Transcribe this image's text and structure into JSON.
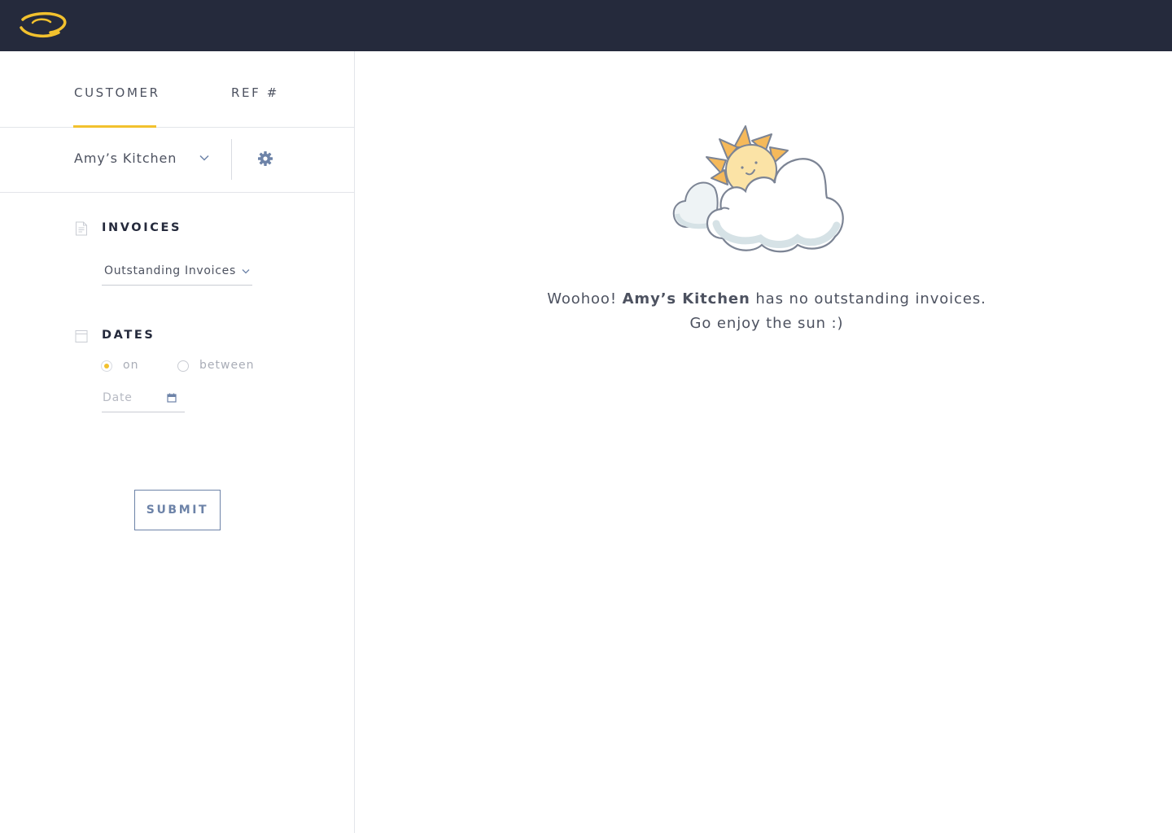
{
  "app": {
    "brand_color": "#f2c12e",
    "topbar_color": "#252a3c",
    "accent_color": "#6d83a8"
  },
  "tabs": [
    {
      "label": "CUSTOMER",
      "active": true
    },
    {
      "label": "REF #",
      "active": false
    }
  ],
  "customer": {
    "selected": "Amy’s Kitchen"
  },
  "invoices": {
    "title": "INVOICES",
    "selected_filter": "Outstanding Invoices"
  },
  "dates": {
    "title": "DATES",
    "options": [
      {
        "label": "on",
        "selected": true
      },
      {
        "label": "between",
        "selected": false
      }
    ],
    "date_placeholder": "Date"
  },
  "submit_label": "SUBMIT",
  "message": {
    "prefix": "Woohoo!",
    "customer": "Amy’s Kitchen",
    "suffix": "has no outstanding invoices.",
    "line2": "Go enjoy the sun :)"
  }
}
